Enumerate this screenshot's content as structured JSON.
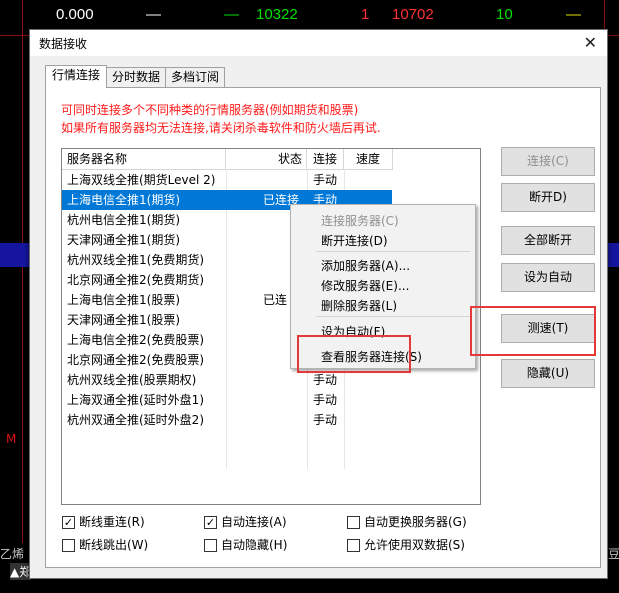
{
  "background": {
    "top_row": [
      "0.000",
      "—",
      "—",
      "10322",
      "1",
      "10702",
      "10",
      "—"
    ],
    "bottom_labels": [
      "乙烯",
      "▲郑",
      "豆"
    ],
    "red_marker": "M"
  },
  "dialog": {
    "title": "数据接收",
    "close_label": "✕",
    "tabs": [
      "行情连接",
      "分时数据",
      "多档订阅"
    ],
    "notice_line1": "可同时连接多个不同种类的行情服务器(例如期货和股票)",
    "notice_line2": "如果所有服务器均无法连接,请关闭杀毒软件和防火墙后再试.",
    "columns": [
      "服务器名称",
      "状态",
      "连接",
      "速度"
    ],
    "servers": [
      {
        "name": "上海双线全推(期货Level 2)",
        "status": "",
        "conn": "手动"
      },
      {
        "name": "上海电信全推1(期货)",
        "status": "已连接",
        "conn": "手动"
      },
      {
        "name": "杭州电信全推1(期货)",
        "status": "",
        "conn": ""
      },
      {
        "name": "天津网通全推1(期货)",
        "status": "",
        "conn": ""
      },
      {
        "name": "杭州双线全推1(免费期货)",
        "status": "",
        "conn": ""
      },
      {
        "name": "北京网通全推2(免费期货)",
        "status": "",
        "conn": ""
      },
      {
        "name": "上海电信全推1(股票)",
        "status": "已连",
        "conn": ""
      },
      {
        "name": "天津网通全推1(股票)",
        "status": "",
        "conn": ""
      },
      {
        "name": "上海电信全推2(免费股票)",
        "status": "",
        "conn": ""
      },
      {
        "name": "北京网通全推2(免费股票)",
        "status": "",
        "conn": ""
      },
      {
        "name": "杭州双线全推(股票期权)",
        "status": "",
        "conn": "手动"
      },
      {
        "name": "上海双通全推(延时外盘1)",
        "status": "",
        "conn": "手动"
      },
      {
        "name": "杭州双通全推(延时外盘2)",
        "status": "",
        "conn": "手动"
      }
    ],
    "buttons": {
      "connect": "连接(C)",
      "disconnect": "断开D)",
      "disconnect_all": "全部断开",
      "set_auto": "设为自动",
      "speed_test": "测速(T)",
      "hide": "隐藏(U)"
    },
    "checkboxes": [
      {
        "label": "断线重连(R)",
        "checked": true
      },
      {
        "label": "自动连接(A)",
        "checked": true
      },
      {
        "label": "自动更换服务器(G)",
        "checked": false
      },
      {
        "label": "断线跳出(W)",
        "checked": false
      },
      {
        "label": "自动隐藏(H)",
        "checked": false
      },
      {
        "label": "允许使用双数据(S)",
        "checked": false
      }
    ],
    "context_menu": {
      "connect_server": "连接服务器(C)",
      "disconnect": "断开连接(D)",
      "add_server": "添加服务器(A)...",
      "modify_server": "修改服务器(E)...",
      "delete_server": "删除服务器(L)",
      "set_auto": "设为自动(F)",
      "view_connections": "查看服务器连接(S)"
    }
  },
  "colors": {
    "selection": "#0078d7",
    "notice": "#ff1a1a",
    "highlight_box": "#e23a3a",
    "terminal_red": "#8a1010",
    "terminal_green": "#00e000"
  }
}
